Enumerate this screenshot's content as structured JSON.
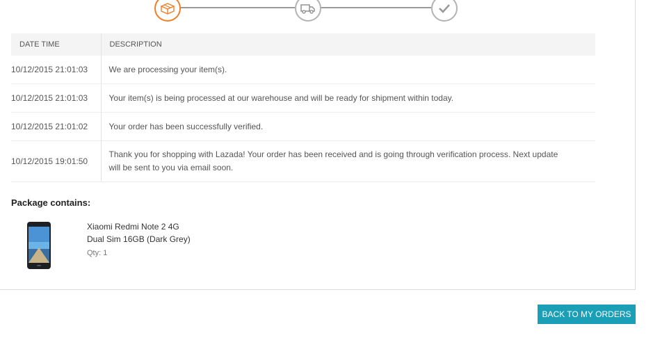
{
  "tracker": {
    "steps": [
      {
        "icon": "open-box-icon",
        "state": "done"
      },
      {
        "icon": "delivery-truck-icon",
        "state": "pending"
      },
      {
        "icon": "checkmark-icon",
        "state": "pending"
      }
    ],
    "colors": {
      "done": "#f07e26",
      "pending": "#b3b3b3",
      "line": "#9a9a9a"
    }
  },
  "history": {
    "headers": {
      "datetime": "DATE TIME",
      "description": "DESCRIPTION"
    },
    "rows": [
      {
        "datetime": "10/12/2015 21:01:03",
        "description": "We are processing your item(s)."
      },
      {
        "datetime": "10/12/2015 21:01:03",
        "description": "Your item(s) is being processed at our warehouse and will be ready for shipment within today."
      },
      {
        "datetime": "10/12/2015 21:01:02",
        "description": "Your order has been successfully verified."
      },
      {
        "datetime": "10/12/2015 19:01:50",
        "description": "Thank you for shopping with Lazada! Your order has been received and is going through verification process. Next update will be sent to you via email soon."
      }
    ]
  },
  "package": {
    "title": "Package contains:",
    "item": {
      "name_line1": "Xiaomi Redmi Note 2 4G",
      "name_line2": "Dual Sim 16GB (Dark Grey)",
      "qty": "Qty: 1"
    }
  },
  "actions": {
    "back_label": "BACK TO MY ORDERS",
    "back_color": "#1a9fb7"
  }
}
